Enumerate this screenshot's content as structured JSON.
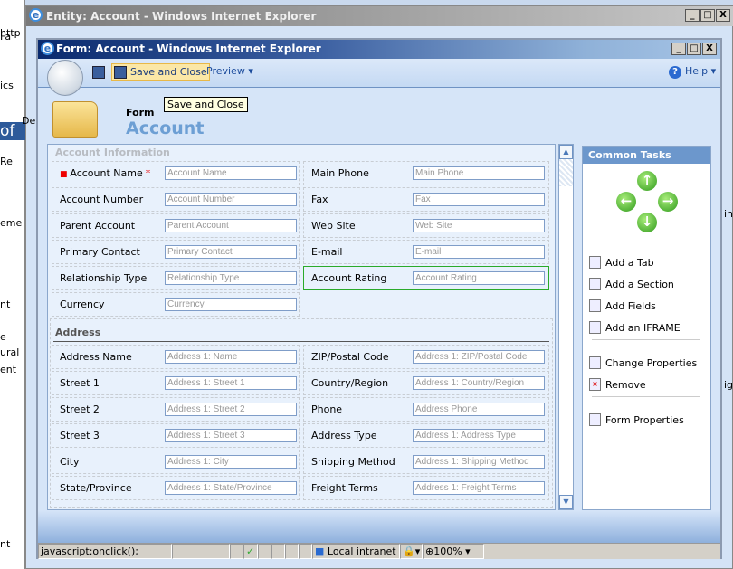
{
  "background_window": {
    "title": "Entity: Account - Windows Internet Explorer",
    "fragments_left": [
      "http",
      "Fa",
      "ics",
      "of",
      "Re",
      "De",
      "eme",
      "nt",
      "e",
      "ural",
      "ent",
      "nt"
    ],
    "fragments_right": [
      "in",
      "igh"
    ]
  },
  "window": {
    "title": "Form: Account - Windows Internet Explorer",
    "controls": {
      "minimize": "_",
      "maximize": "□",
      "close": "X"
    }
  },
  "toolbar": {
    "save_label": "Save and Close",
    "preview_label": "Preview ▾",
    "help_label": "Help ▾",
    "tooltip": "Save and Close"
  },
  "header": {
    "form_label": "Form",
    "entity": "Account"
  },
  "sections": [
    {
      "title": "Account Information",
      "rows": [
        [
          {
            "label": "Account Name",
            "required": true,
            "placeholder": "Account Name"
          },
          {
            "label": "Main Phone",
            "placeholder": "Main Phone"
          }
        ],
        [
          {
            "label": "Account Number",
            "placeholder": "Account Number"
          },
          {
            "label": "Fax",
            "placeholder": "Fax"
          }
        ],
        [
          {
            "label": "Parent Account",
            "placeholder": "Parent Account"
          },
          {
            "label": "Web Site",
            "placeholder": "Web Site"
          }
        ],
        [
          {
            "label": "Primary Contact",
            "placeholder": "Primary Contact"
          },
          {
            "label": "E-mail",
            "placeholder": "E-mail"
          }
        ],
        [
          {
            "label": "Relationship Type",
            "placeholder": "Relationship Type"
          },
          {
            "label": "Account Rating",
            "placeholder": "Account Rating",
            "selected": true
          }
        ],
        [
          {
            "label": "Currency",
            "placeholder": "Currency"
          },
          null
        ]
      ]
    },
    {
      "title": "Address",
      "rows": [
        [
          {
            "label": "Address Name",
            "placeholder": "Address 1: Name"
          },
          {
            "label": "ZIP/Postal Code",
            "placeholder": "Address 1: ZIP/Postal Code"
          }
        ],
        [
          {
            "label": "Street 1",
            "placeholder": "Address 1: Street 1"
          },
          {
            "label": "Country/Region",
            "placeholder": "Address 1: Country/Region"
          }
        ],
        [
          {
            "label": "Street 2",
            "placeholder": "Address 1: Street 2"
          },
          {
            "label": "Phone",
            "placeholder": "Address Phone"
          }
        ],
        [
          {
            "label": "Street 3",
            "placeholder": "Address 1: Street 3"
          },
          {
            "label": "Address Type",
            "placeholder": "Address 1: Address Type"
          }
        ],
        [
          {
            "label": "City",
            "placeholder": "Address 1: City"
          },
          {
            "label": "Shipping Method",
            "placeholder": "Address 1: Shipping Method"
          }
        ],
        [
          {
            "label": "State/Province",
            "placeholder": "Address 1: State/Province"
          },
          {
            "label": "Freight Terms",
            "placeholder": "Address 1: Freight Terms"
          }
        ]
      ]
    }
  ],
  "required_marker": "*",
  "common_tasks": {
    "title": "Common Tasks",
    "arrows": {
      "up": "↑",
      "left": "←",
      "right": "→",
      "down": "↓"
    },
    "groups": [
      [
        {
          "label": "Add a Tab",
          "icon": "add-tab-icon"
        },
        {
          "label": "Add a Section",
          "icon": "add-section-icon"
        },
        {
          "label": "Add Fields",
          "icon": "add-fields-icon"
        },
        {
          "label": "Add an IFRAME",
          "icon": "add-iframe-icon"
        }
      ],
      [
        {
          "label": "Change Properties",
          "icon": "change-properties-icon"
        },
        {
          "label": "Remove",
          "icon": "remove-icon"
        }
      ],
      [
        {
          "label": "Form Properties",
          "icon": "form-properties-icon"
        }
      ]
    ]
  },
  "statusbar": {
    "text": "javascript:onclick();",
    "zone": "Local intranet",
    "zoom": "100%"
  }
}
